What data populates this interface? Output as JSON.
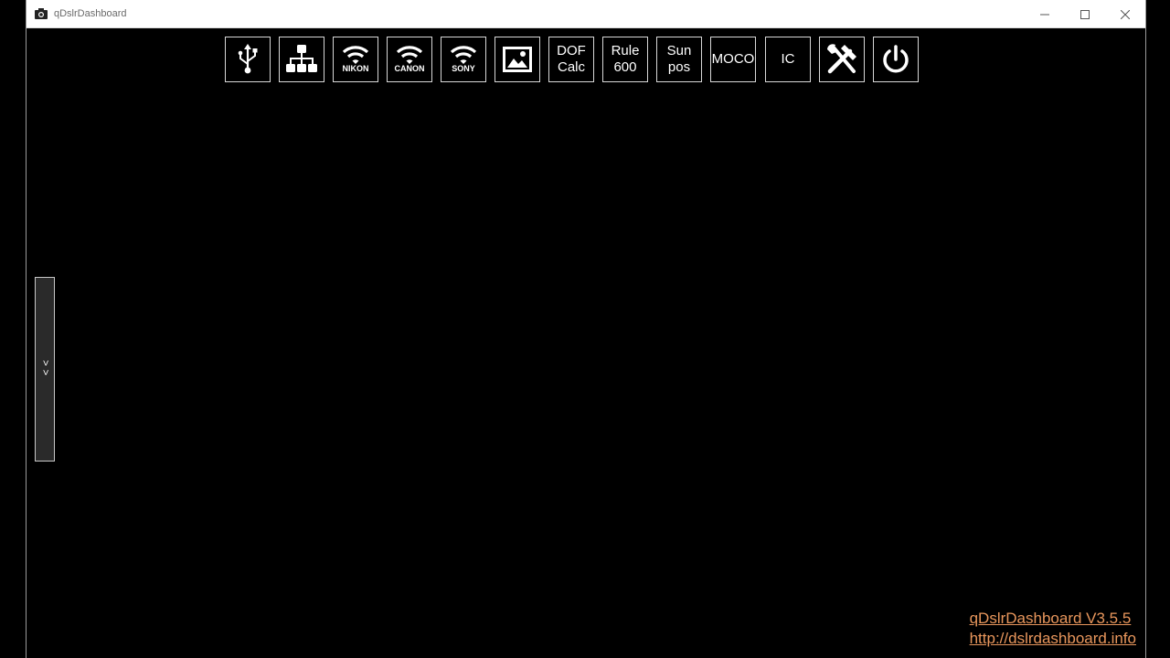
{
  "window": {
    "title": "qDslrDashboard"
  },
  "toolbar": {
    "buttons": [
      {
        "name": "usb-connect-button",
        "icon": "usb-icon"
      },
      {
        "name": "network-connect-button",
        "icon": "network-icon"
      },
      {
        "name": "nikon-wifi-button",
        "icon": "wifi-icon",
        "label": "NIKON"
      },
      {
        "name": "canon-wifi-button",
        "icon": "wifi-icon",
        "label": "CANON"
      },
      {
        "name": "sony-wifi-button",
        "icon": "wifi-icon",
        "label": "SONY"
      },
      {
        "name": "image-viewer-button",
        "icon": "image-icon"
      },
      {
        "name": "dof-calc-button",
        "label": "DOF\nCalc"
      },
      {
        "name": "rule-600-button",
        "label": "Rule\n600"
      },
      {
        "name": "sun-pos-button",
        "label": "Sun\npos"
      },
      {
        "name": "moco-button",
        "label": "MOCO"
      },
      {
        "name": "ic-button",
        "label": "IC"
      },
      {
        "name": "tools-button",
        "icon": "tools-icon"
      },
      {
        "name": "power-button",
        "icon": "power-icon"
      }
    ]
  },
  "sidebar_toggle": {
    "label": ">>"
  },
  "footer": {
    "version": "qDslrDashboard V3.5.5",
    "url": "http://dslrdashboard.info"
  },
  "colors": {
    "background": "#000000",
    "link": "#e8965c",
    "button_border": "#d8d8d8"
  }
}
